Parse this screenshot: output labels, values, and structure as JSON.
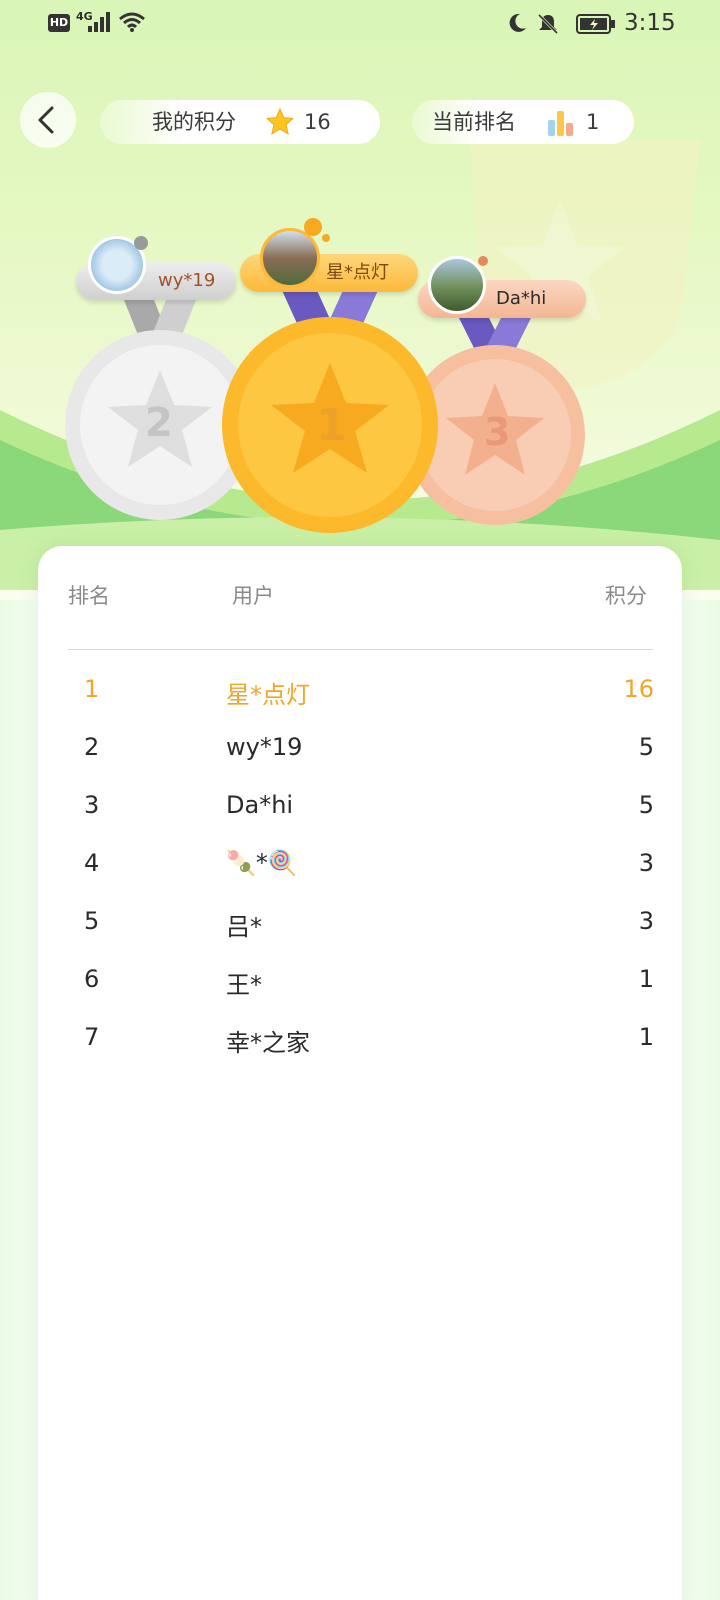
{
  "status_bar": {
    "hd": "HD",
    "network": "4G",
    "time": "3:15"
  },
  "header": {
    "my_points_label": "我的积分",
    "my_points_value": "16",
    "current_rank_label": "当前排名",
    "current_rank_value": "1"
  },
  "podium": {
    "first": {
      "name": "星*点灯",
      "rank": "1"
    },
    "second": {
      "name": "wy*19",
      "rank": "2"
    },
    "third": {
      "name": "Da*hi",
      "rank": "3"
    }
  },
  "table": {
    "headers": {
      "rank": "排名",
      "user": "用户",
      "points": "积分"
    },
    "rows": [
      {
        "rank": "1",
        "user": "星*点灯",
        "points": "16"
      },
      {
        "rank": "2",
        "user": "wy*19",
        "points": "5"
      },
      {
        "rank": "3",
        "user": "Da*hi",
        "points": "5"
      },
      {
        "rank": "4",
        "user": "🍡*🍭",
        "points": "3"
      },
      {
        "rank": "5",
        "user": "吕*",
        "points": "3"
      },
      {
        "rank": "6",
        "user": "王*",
        "points": "1"
      },
      {
        "rank": "7",
        "user": "幸*之家",
        "points": "1"
      }
    ]
  },
  "colors": {
    "accent_gold": "#f2a528",
    "silver": "#e4e4e4",
    "bronze": "#f3b795",
    "ribbon_purple": "#7b5fc9",
    "bg_green": "#d9f5b7"
  },
  "icons": {
    "back": "back-arrow-icon",
    "points": "star-icon",
    "rank": "bar-chart-icon"
  }
}
